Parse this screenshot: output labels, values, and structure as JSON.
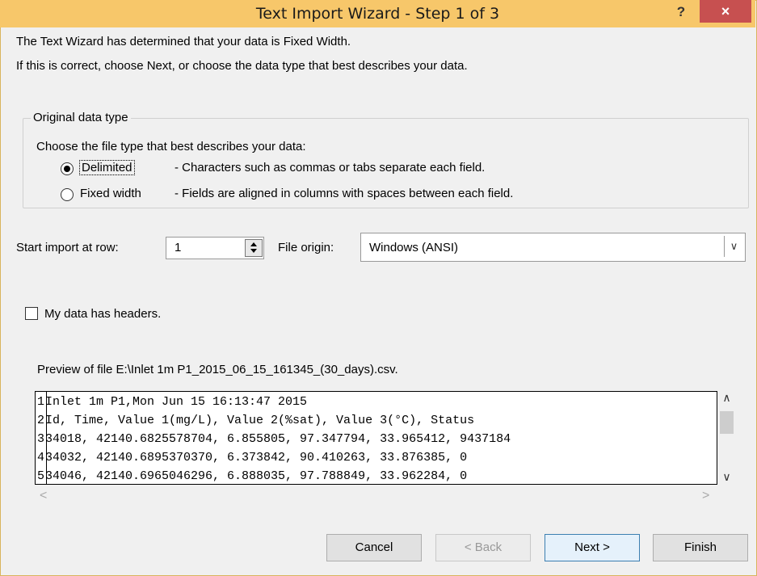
{
  "window": {
    "title": "Text Import Wizard - Step 1 of 3",
    "help_label": "?",
    "close_label": "×"
  },
  "intro": {
    "line1": "The Text Wizard has determined that your data is Fixed Width.",
    "line2": "If this is correct, choose Next, or choose the data type that best describes your data."
  },
  "original_data_type": {
    "group_title": "Original data type",
    "prompt": "Choose the file type that best describes your data:",
    "options": [
      {
        "label": "Delimited",
        "description": "- Characters such as commas or tabs separate each field.",
        "selected": true
      },
      {
        "label": "Fixed width",
        "description": "- Fields are aligned in columns with spaces between each field.",
        "selected": false
      }
    ]
  },
  "start_row": {
    "label": "Start import at row:",
    "value": "1"
  },
  "file_origin": {
    "label": "File origin:",
    "value": "Windows (ANSI)"
  },
  "headers_checkbox": {
    "label": "My data has headers.",
    "checked": false
  },
  "preview": {
    "label": "Preview of file E:\\Inlet 1m P1_2015_06_15_161345_(30_days).csv.",
    "lines": [
      {
        "num": "1",
        "text": "Inlet 1m P1,Mon Jun 15 16:13:47 2015"
      },
      {
        "num": "2",
        "text": "Id, Time, Value 1(mg/L), Value 2(%sat), Value 3(°C), Status"
      },
      {
        "num": "3",
        "text": "34018, 42140.6825578704, 6.855805, 97.347794, 33.965412, 9437184"
      },
      {
        "num": "4",
        "text": "34032, 42140.6895370370, 6.373842, 90.410263, 33.876385, 0"
      },
      {
        "num": "5",
        "text": "34046, 42140.6965046296, 6.888035, 97.788849, 33.962284, 0"
      }
    ]
  },
  "buttons": {
    "cancel": "Cancel",
    "back": "< Back",
    "next": "Next >",
    "finish": "Finish"
  }
}
